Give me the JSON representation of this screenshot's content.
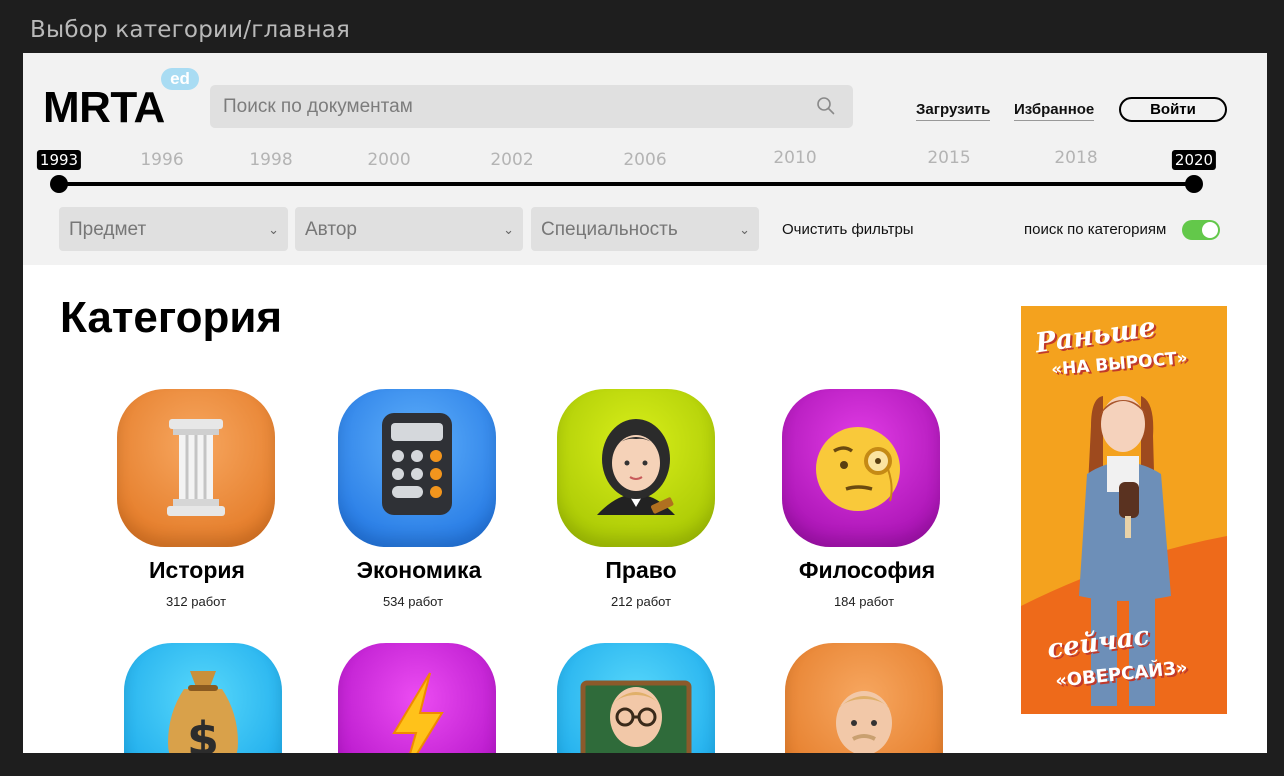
{
  "frame": {
    "title": "Выбор категории/главная"
  },
  "header": {
    "logo": "MRTA",
    "logo_badge": "ed",
    "search_placeholder": "Поиск по документам",
    "nav": {
      "upload": "Загрузить",
      "favorites": "Избранное",
      "login": "Войти"
    }
  },
  "timeline": {
    "start": "1993",
    "end": "2020",
    "years": [
      "1996",
      "1998",
      "2000",
      "2002",
      "2006",
      "2010",
      "2015",
      "2018"
    ]
  },
  "filters": {
    "subject": "Предмет",
    "author": "Автор",
    "specialty": "Специальность",
    "clear": "Очистить фильтры",
    "category_search_label": "поиск по категориям",
    "category_search_on": true
  },
  "main": {
    "heading": "Категория",
    "categories": [
      {
        "name": "История",
        "count": "312 работ",
        "icon": "column-icon",
        "color": "#f08a3c"
      },
      {
        "name": "Экономика",
        "count": "534 работ",
        "icon": "calculator-icon",
        "color": "#2f8ef5"
      },
      {
        "name": "Право",
        "count": "212 работ",
        "icon": "judge-icon",
        "color": "#b8d800"
      },
      {
        "name": "Философия",
        "count": "184 работ",
        "icon": "monocle-face-icon",
        "color": "#c414c8"
      },
      {
        "name": "",
        "count": "",
        "icon": "money-bag-icon",
        "color": "#22c3f5"
      },
      {
        "name": "",
        "count": "",
        "icon": "lightning-icon",
        "color": "#c112d6"
      },
      {
        "name": "",
        "count": "",
        "icon": "teacher-icon",
        "color": "#2bb8ef"
      },
      {
        "name": "",
        "count": "",
        "icon": "doctor-icon",
        "color": "#f08a3c"
      }
    ]
  },
  "ad": {
    "line1": "Раньше",
    "line2": "«НА ВЫРОСТ»",
    "line3": "сейчас",
    "line4": "«ОВЕРСАЙЗ»"
  }
}
